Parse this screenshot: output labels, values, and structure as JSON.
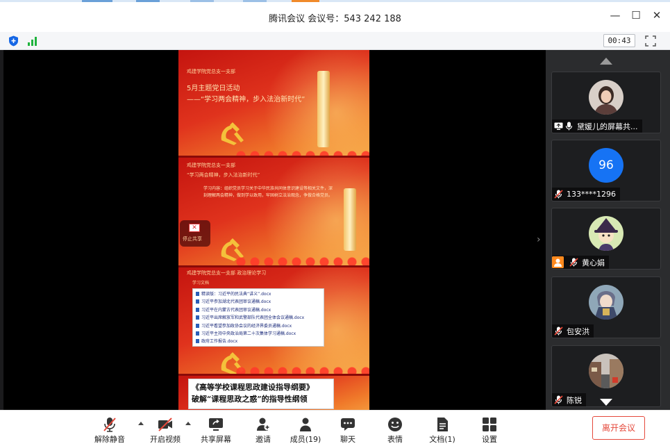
{
  "window": {
    "title": "腾讯会议  会议号：543 242 188",
    "minimize_glyph": "—",
    "maximize_glyph": "☐",
    "close_glyph": "✕"
  },
  "status": {
    "timer": "00:43",
    "security_icon": "shield-icon",
    "network_icon": "signal-bars-icon",
    "fullscreen_icon": "fullscreen-icon",
    "signal_color": "#1fb33d"
  },
  "shared_document": {
    "slide1": {
      "header": "鸡建学院党总支一支部",
      "title_line1": "5月主题党日活动",
      "title_line2": "——“学习两会精神，步入法治新时代”"
    },
    "slide2": {
      "header": "鸡建学院党总支一支部",
      "subtitle": "“学习两会精神，步入法治新时代”",
      "body": "学习内容：组织党员学习关于中华民族共同体意识建设等相关文件，深刻理解两会精神，做到学以致用，牢固树立法治观念，争做合格党员。",
      "close_label": "停止共享",
      "close_glyph": "✕"
    },
    "slide3": {
      "header": "鸡建学院党总支一支部  政治理论学习",
      "section": "学习文档",
      "files": [
        "精读版：习近平的民法典“讲义”.docx",
        "习近平参加湖北代表团审议通稿.docx",
        "习近平在内蒙古代表团审议通稿.docx",
        "习近平出席解放军和武警部队代表团全体会议通稿.docx",
        "习近平看望参加政协会议的经济界委员通稿.docx",
        "习近平主持中央政治局第二十次集体学习通稿.docx",
        "政府工作报告.docx"
      ]
    },
    "slide4": {
      "line1": "《高等学校课程思政建设指导纲要》",
      "line2": "破解“课程思政之惑”的指导性纲领"
    },
    "expand_glyph": "›"
  },
  "participants": [
    {
      "name": "黛媛儿的屏幕共...",
      "avatar": "photo-woman",
      "icons": [
        "screen-share-icon",
        "mic-on-icon"
      ],
      "host": false
    },
    {
      "name": "133****1296",
      "avatar_text": "96",
      "avatar_color": "#1673f4",
      "icons": [
        "mic-muted-icon"
      ],
      "host": false
    },
    {
      "name": "黄心娟",
      "avatar": "cartoon-witch",
      "icons": [
        "host-icon",
        "mic-muted-icon"
      ],
      "host": true
    },
    {
      "name": "包安洪",
      "avatar": "anime-character",
      "icons": [
        "mic-muted-icon"
      ],
      "host": false
    },
    {
      "name": "陈锐",
      "avatar": "street-photo",
      "icons": [
        "mic-muted-icon"
      ],
      "host": false
    }
  ],
  "toolbar": {
    "unmute": "解除静音",
    "video": "开启视频",
    "share": "共享屏幕",
    "invite": "邀请",
    "members": "成员(19)",
    "chat": "聊天",
    "emoji": "表情",
    "docs": "文档(1)",
    "settings": "设置",
    "leave": "离开会议",
    "accent": "#e5493b"
  }
}
